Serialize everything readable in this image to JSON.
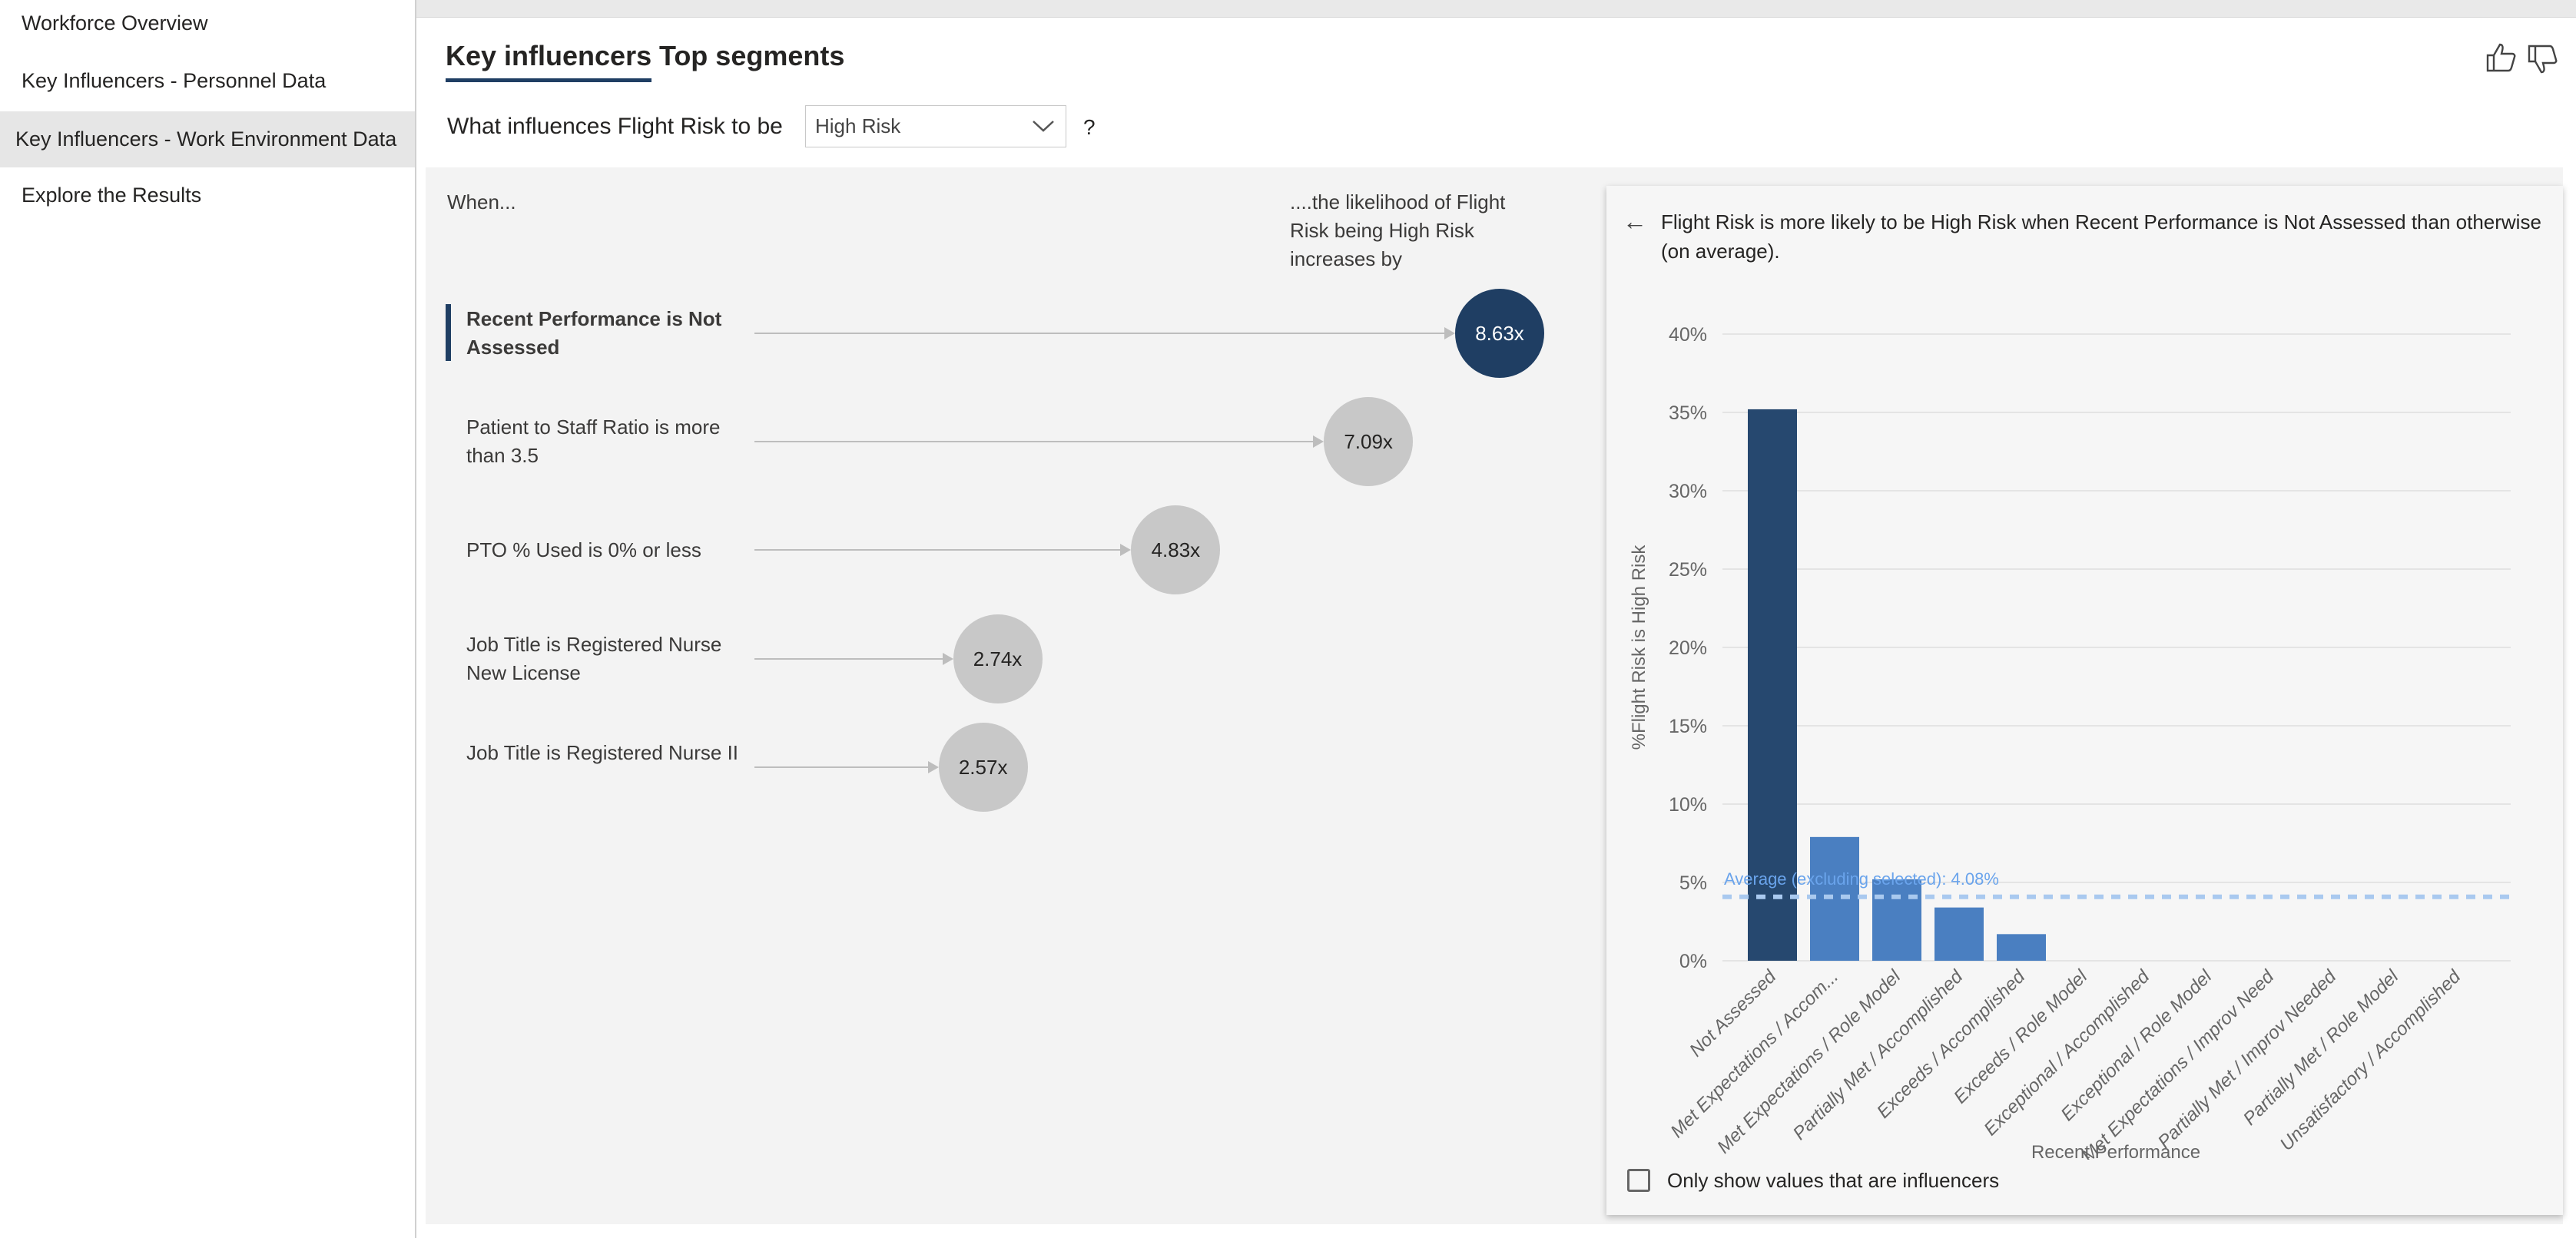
{
  "sidebar": {
    "items": [
      {
        "label": "Workforce Overview",
        "selected": false
      },
      {
        "label": "Key Influencers - Personnel Data",
        "selected": false
      },
      {
        "label": "Key Influencers - Work Environment Data",
        "selected": true
      },
      {
        "label": "Explore the Results",
        "selected": false
      }
    ]
  },
  "tabs": [
    {
      "label": "Key influencers",
      "active": true
    },
    {
      "label": "Top segments",
      "active": false
    }
  ],
  "feedback": {
    "thumbs_up_icon": "thumbs-up-icon",
    "thumbs_down_icon": "thumbs-down-icon"
  },
  "question": {
    "prefix": "What influences Flight Risk to be",
    "selected_value": "High Risk",
    "suffix": "?"
  },
  "influencers": {
    "when_header": "When...",
    "likelihood_header": "....the likelihood of Flight Risk being High Risk increases by",
    "items": [
      {
        "label": "Recent Performance is Not Assessed",
        "value": "8.63x",
        "multiplier": 8.63,
        "selected": true
      },
      {
        "label": "Patient to Staff Ratio is more than 3.5",
        "value": "7.09x",
        "multiplier": 7.09,
        "selected": false
      },
      {
        "label": "PTO % Used is 0% or less",
        "value": "4.83x",
        "multiplier": 4.83,
        "selected": false
      },
      {
        "label": "Job Title is Registered Nurse New License",
        "value": "2.74x",
        "multiplier": 2.74,
        "selected": false
      },
      {
        "label": "Job Title is Registered Nurse II",
        "value": "2.57x",
        "multiplier": 2.57,
        "selected": false
      }
    ]
  },
  "detail": {
    "header": "Flight Risk is more likely to be High Risk when Recent Performance is Not Assessed than otherwise (on average).",
    "checkbox_label": "Only show values that are influencers",
    "checkbox_checked": false
  },
  "colors": {
    "selected": "#26486f",
    "bar": "#4a7fc1",
    "average_line": "#a9c9ef",
    "average_text": "#6aa4ec",
    "bubble": "#c8c8c8"
  },
  "chart_data": {
    "type": "bar",
    "xlabel": "Recent Performance",
    "ylabel": "%Flight Risk is High Risk",
    "ylim": [
      0,
      40
    ],
    "yticks": [
      "0%",
      "5%",
      "10%",
      "15%",
      "20%",
      "25%",
      "30%",
      "35%",
      "40%"
    ],
    "grid": true,
    "categories": [
      "Not Assessed",
      "Met Expectations / Accom...",
      "Met Expectations / Role Model",
      "Partially Met / Accomplished",
      "Exceeds / Accomplished",
      "Exceeds / Role Model",
      "Exceptional / Accomplished",
      "Exceptional / Role Model",
      "Met Expectations / Improv Need",
      "Partially Met / Improv Needed",
      "Partially Met / Role Model",
      "Unsatisfactory / Accomplished"
    ],
    "values": [
      35.2,
      7.9,
      5.2,
      3.4,
      1.7,
      0,
      0,
      0,
      0,
      0,
      0,
      0
    ],
    "highlighted_index": 0,
    "average": {
      "label": "Average (excluding selected): 4.08%",
      "value": 4.08
    }
  }
}
